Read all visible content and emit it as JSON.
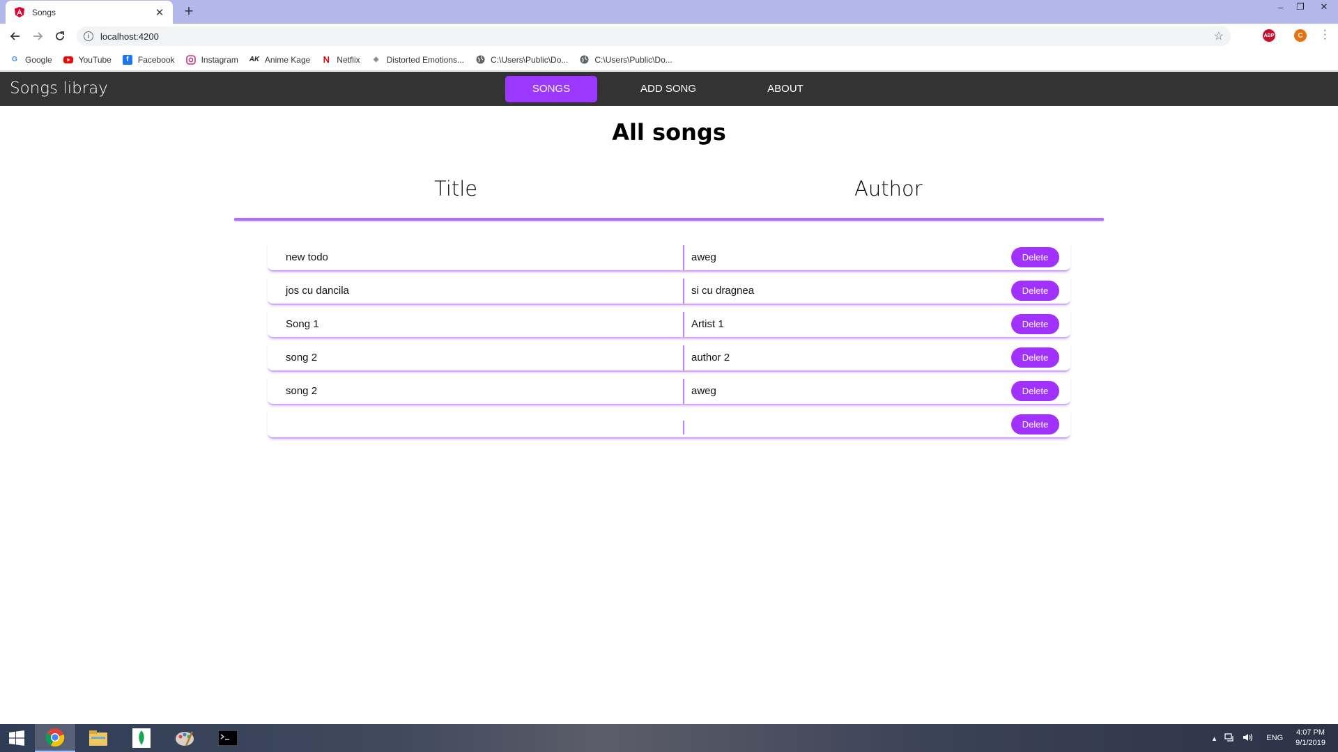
{
  "browser": {
    "tab_title": "Songs",
    "url": "localhost:4200",
    "bookmarks": [
      {
        "label": "Google",
        "icon": "google-icon"
      },
      {
        "label": "YouTube",
        "icon": "youtube-icon"
      },
      {
        "label": "Facebook",
        "icon": "facebook-icon"
      },
      {
        "label": "Instagram",
        "icon": "instagram-icon"
      },
      {
        "label": "Anime Kage",
        "icon": "animekage-icon"
      },
      {
        "label": "Netflix",
        "icon": "netflix-icon"
      },
      {
        "label": "Distorted Emotions...",
        "icon": "page-icon"
      },
      {
        "label": "C:\\Users\\Public\\Do...",
        "icon": "globe-icon"
      },
      {
        "label": "C:\\Users\\Public\\Do...",
        "icon": "globe-icon"
      }
    ],
    "extensions": {
      "abp": "ABP",
      "profile_initial": "C"
    }
  },
  "app": {
    "brand": "Songs libray",
    "nav": [
      {
        "label": "SONGS",
        "active": true
      },
      {
        "label": "ADD SONG",
        "active": false
      },
      {
        "label": "ABOUT",
        "active": false
      }
    ]
  },
  "main": {
    "title": "All songs",
    "columns": {
      "title": "Title",
      "author": "Author"
    },
    "delete_label": "Delete",
    "rows": [
      {
        "title": "new todo",
        "author": "aweg"
      },
      {
        "title": "jos cu dancila",
        "author": "si cu dragnea"
      },
      {
        "title": "Song 1",
        "author": "Artist 1"
      },
      {
        "title": "song 2",
        "author": "author 2"
      },
      {
        "title": "song 2",
        "author": "aweg"
      },
      {
        "title": "",
        "author": ""
      }
    ]
  },
  "taskbar": {
    "language": "ENG",
    "time": "4:07 PM",
    "date": "9/1/2019"
  },
  "colors": {
    "accent": "#9b37ff",
    "navbar": "#333333",
    "tabstrip": "#b3b8ea"
  }
}
